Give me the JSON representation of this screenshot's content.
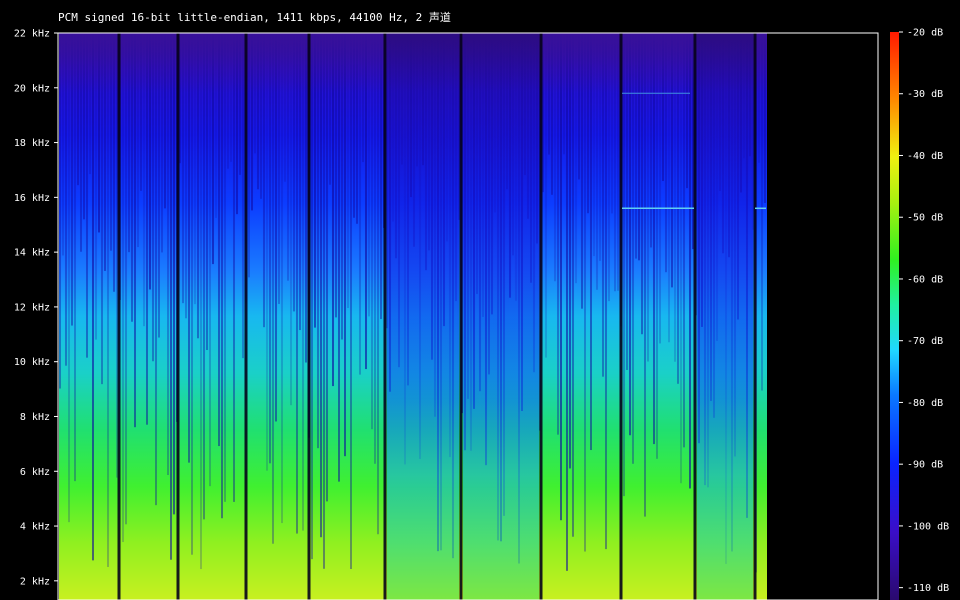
{
  "chart_data": {
    "type": "heatmap",
    "title": "PCM signed 16-bit little-endian, 1411 kbps, 44100 Hz, 2 声道",
    "xlabel": "",
    "ylabel": "",
    "y_unit": "kHz",
    "ylim": [
      1.3,
      22
    ],
    "y_ticks": [
      {
        "value": 22,
        "label": "22 kHz"
      },
      {
        "value": 20,
        "label": "20 kHz"
      },
      {
        "value": 18,
        "label": "18 kHz"
      },
      {
        "value": 16,
        "label": "16 kHz"
      },
      {
        "value": 14,
        "label": "14 kHz"
      },
      {
        "value": 12,
        "label": "12 kHz"
      },
      {
        "value": 10,
        "label": "10 kHz"
      },
      {
        "value": 8,
        "label": "8 kHz"
      },
      {
        "value": 6,
        "label": "6 kHz"
      },
      {
        "value": 4,
        "label": "4 kHz"
      },
      {
        "value": 2,
        "label": "2 kHz"
      }
    ],
    "colorbar": {
      "min_db": -112,
      "max_db": -20,
      "ticks": [
        {
          "value": -20,
          "label": "-20 dB"
        },
        {
          "value": -30,
          "label": "-30 dB"
        },
        {
          "value": -40,
          "label": "-40 dB"
        },
        {
          "value": -50,
          "label": "-50 dB"
        },
        {
          "value": -60,
          "label": "-60 dB"
        },
        {
          "value": -70,
          "label": "-70 dB"
        },
        {
          "value": -80,
          "label": "-80 dB"
        },
        {
          "value": -90,
          "label": "-90 dB"
        },
        {
          "value": -100,
          "label": "-100 dB"
        },
        {
          "value": -110,
          "label": "-110 dB"
        }
      ]
    },
    "grid": false,
    "track_count": 11,
    "background": "#000000",
    "foreground": "#ffffff"
  }
}
